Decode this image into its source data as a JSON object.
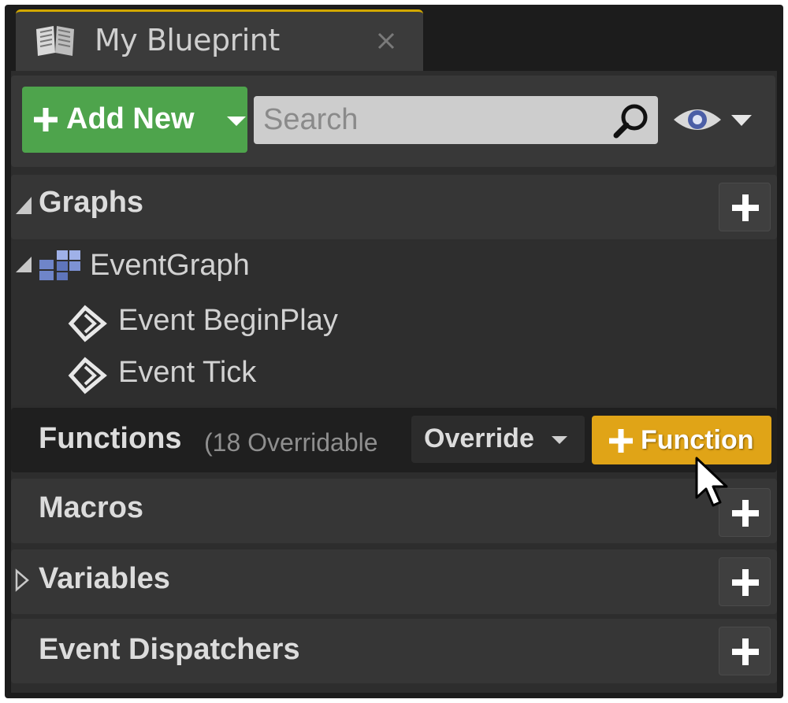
{
  "tab": {
    "title": "My Blueprint",
    "icon": "book-icon",
    "close_icon": "close-icon"
  },
  "toolbar": {
    "add_new_label": "Add New",
    "search_placeholder": "Search",
    "search_value": "",
    "view_options_icon": "eye-icon"
  },
  "sections": {
    "graphs": {
      "title": "Graphs",
      "items": [
        {
          "label": "EventGraph",
          "icon": "event-graph-icon",
          "expanded": true
        },
        {
          "label": "Event BeginPlay",
          "icon": "event-node-icon"
        },
        {
          "label": "Event Tick",
          "icon": "event-node-icon"
        }
      ]
    },
    "functions": {
      "title": "Functions",
      "note": "(18 Overridable",
      "override_label": "Override",
      "add_label": "Function"
    },
    "macros": {
      "title": "Macros"
    },
    "variables": {
      "title": "Variables"
    },
    "event_dispatchers": {
      "title": "Event Dispatchers"
    }
  },
  "colors": {
    "add_new": "#4ea44c",
    "function_button": "#e0a417",
    "tab_accent": "#d2a800"
  }
}
